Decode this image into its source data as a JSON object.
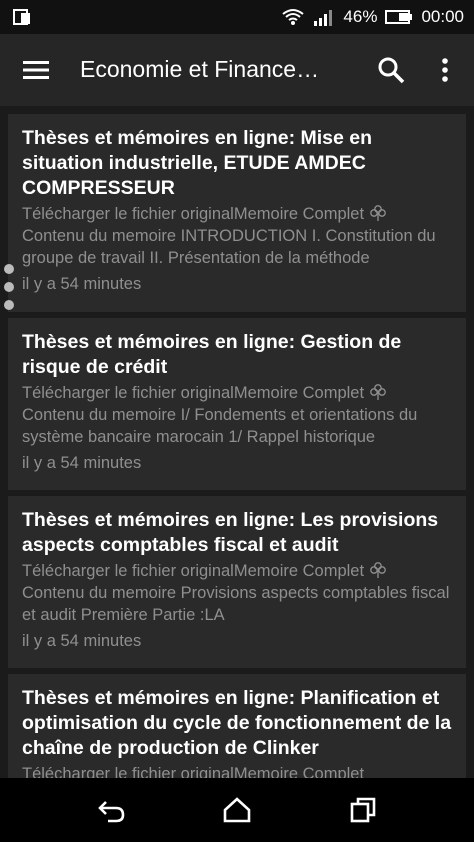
{
  "status": {
    "battery": "46%",
    "time": "00:00"
  },
  "app_bar": {
    "title": "Economie et Finance…"
  },
  "articles": [
    {
      "title": "Thèses et mémoires en ligne: Mise en situation industrielle, ETUDE AMDEC COMPRESSEUR",
      "excerpt_a": "Télécharger le fichier originalMemoire Complet",
      "excerpt_b": "Contenu du memoire INTRODUCTION I.  Constitution du groupe de travail II.  Présentation de la méthode",
      "time": "il y a 54 minutes"
    },
    {
      "title": "Thèses et mémoires en ligne: Gestion de risque de crédit",
      "excerpt_a": "Télécharger le fichier originalMemoire Complet",
      "excerpt_b": "Contenu du memoire I/ Fondements et orientations du système bancaire marocain 1/ Rappel historique",
      "time": "il y a 54 minutes"
    },
    {
      "title": "Thèses et mémoires en ligne: Les provisions aspects comptables fiscal et audit",
      "excerpt_a": "Télécharger le fichier originalMemoire Complet",
      "excerpt_b": "Contenu du memoire Provisions aspects comptables fiscal et audit Première Partie :LA",
      "time": "il y a 54 minutes"
    },
    {
      "title": "Thèses et mémoires en ligne: Planification et optimisation du cycle de fonctionnement de la chaîne de production de Clinker",
      "excerpt_a": "Télécharger le fichier originalMemoire Complet",
      "excerpt_b": "",
      "time": ""
    }
  ],
  "icons": {
    "menu": "hamburger-icon",
    "search": "search-icon",
    "more": "more-vert-icon",
    "clover": "clover-icon",
    "back": "back-icon",
    "home": "home-icon",
    "recents": "recents-icon"
  },
  "colors": {
    "app_bar": "#262626",
    "card": "#2a2a2a",
    "background": "#1b1b1b",
    "muted_text": "#8f8f8f"
  }
}
